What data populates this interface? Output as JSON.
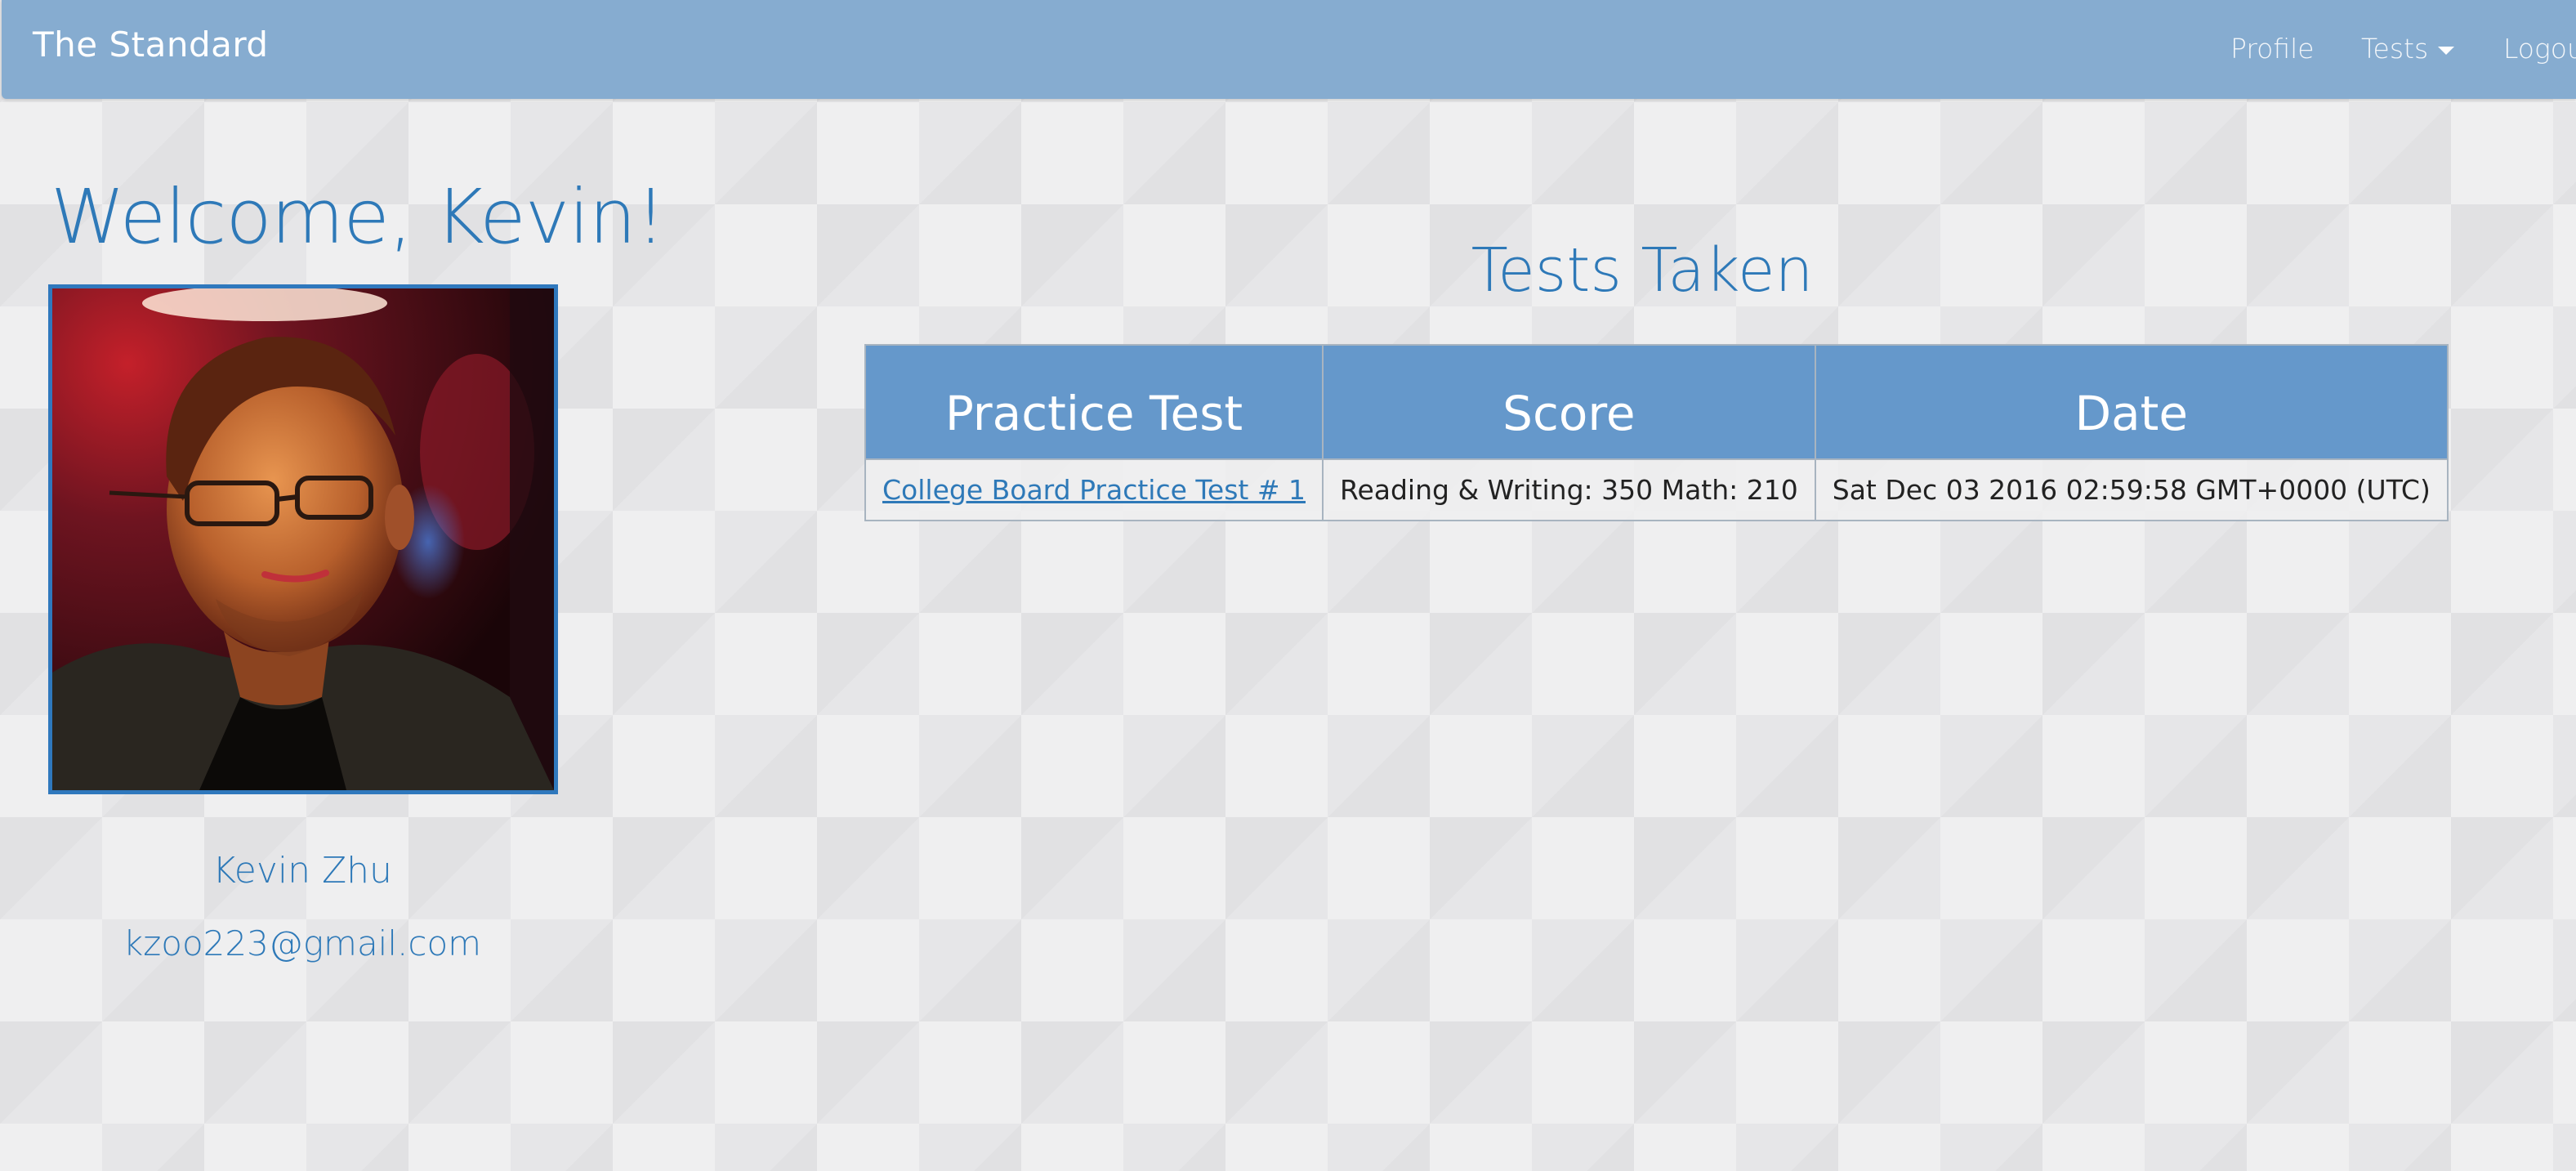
{
  "navbar": {
    "brand": "The Standard",
    "links": {
      "profile": "Profile",
      "tests": "Tests",
      "logout": "Logout"
    },
    "background_color": "#86acd0"
  },
  "profile": {
    "welcome": "Welcome, Kevin!",
    "name": "Kevin Zhu",
    "email": "kzoo223@gmail.com",
    "avatar_alt": "profile photo",
    "accent_color": "#2e79b8"
  },
  "tests_taken": {
    "title": "Tests Taken",
    "headers": {
      "practice_test": "Practice Test",
      "score": "Score",
      "date": "Date"
    },
    "rows": [
      {
        "practice_test": "College Board Practice Test # 1",
        "score": "Reading & Writing: 350 Math: 210",
        "date": "Sat Dec 03 2016 02:59:58 GMT+0000 (UTC)"
      }
    ],
    "header_color": "#6598cb"
  }
}
